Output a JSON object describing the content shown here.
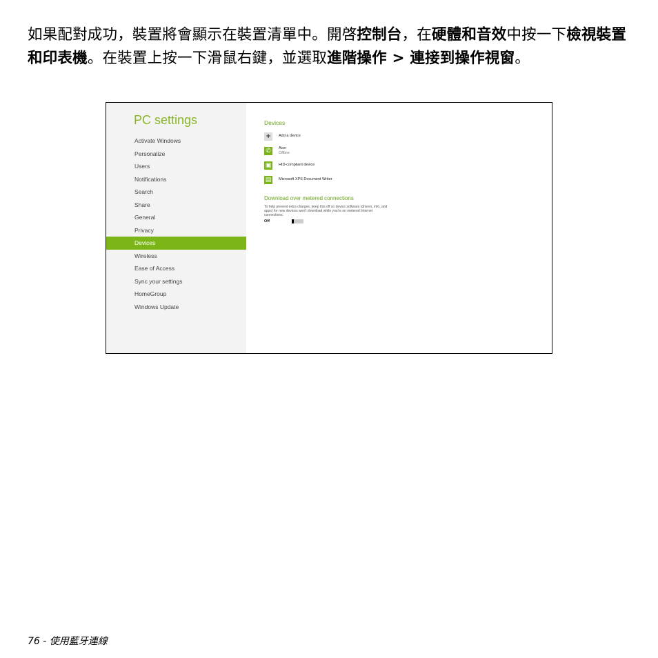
{
  "instruction": {
    "p1": "如果配對成功，裝置將會顯示在裝置清單中。開啓",
    "b1": "控制台",
    "p2": "，在",
    "b2": "硬體和音效",
    "p3": "中按一下",
    "b3": "檢視裝置和印表機",
    "p4": "。在裝置上按一下滑鼠右鍵，並選取",
    "b4": "進階操作 > 連接到操作視窗",
    "p5": "。"
  },
  "screenshot": {
    "title": "PC settings",
    "nav": [
      "Activate Windows",
      "Personalize",
      "Users",
      "Notifications",
      "Search",
      "Share",
      "General",
      "Privacy",
      "Devices",
      "Wireless",
      "Ease of Access",
      "Sync your settings",
      "HomeGroup",
      "Windows Update"
    ],
    "active_nav": "Devices",
    "devices_title": "Devices",
    "devices": [
      {
        "icon": "plus-icon",
        "name": "Add a device",
        "status": ""
      },
      {
        "icon": "phone-icon",
        "name": "Acer",
        "status": "Offline"
      },
      {
        "icon": "hid-device-icon",
        "name": "HID-compliant device",
        "status": ""
      },
      {
        "icon": "document-writer-icon",
        "name": "Microsoft XPS Document Writer",
        "status": ""
      }
    ],
    "download_title": "Download over metered connections",
    "download_desc": "To help prevent extra charges, keep this off so device software (drivers, info, and apps) for new devices won't download while you're on metered Internet connections.",
    "toggle_label": "Off",
    "toggle_state": "off",
    "accent_color": "#7cb518"
  },
  "footer": {
    "page_number": "76",
    "separator": "-",
    "section": "使用藍牙連線"
  }
}
